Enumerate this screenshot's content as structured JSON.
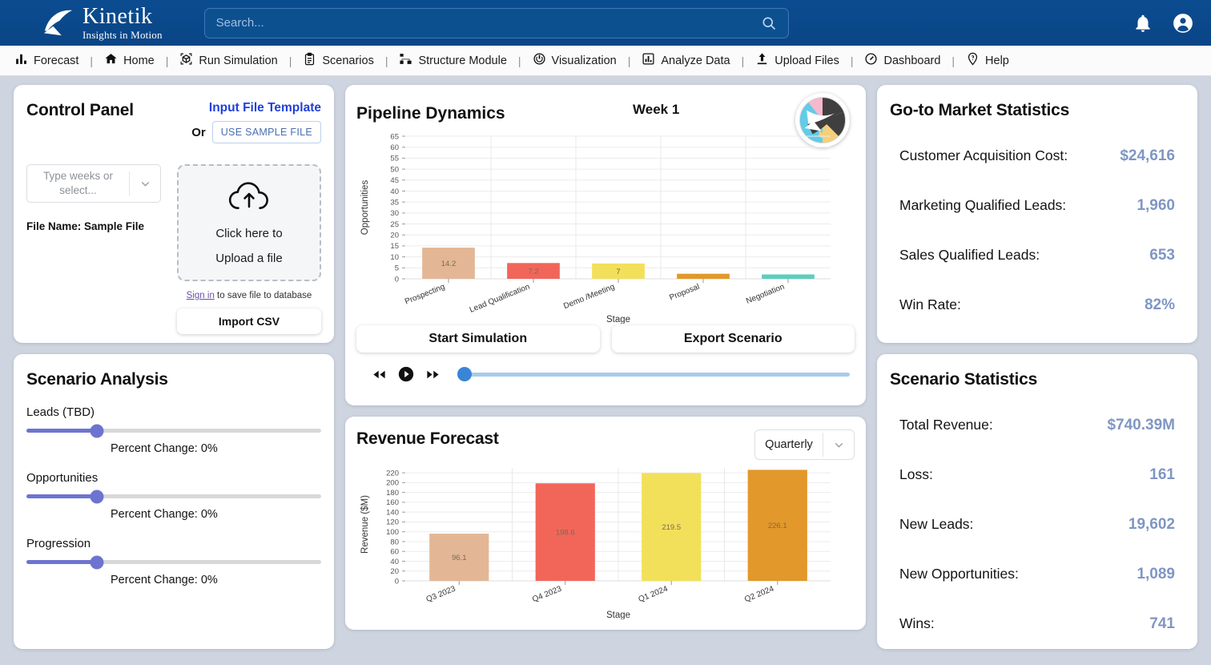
{
  "header": {
    "logo_title": "Kinetik",
    "logo_subtitle": "Insights in Motion",
    "search_placeholder": "Search...",
    "search_value": "",
    "notifications_icon": "bell-icon",
    "account_icon": "account-circle-icon"
  },
  "nav": {
    "items": [
      {
        "label": "Forecast",
        "icon": "bar-chart-icon"
      },
      {
        "label": "Home",
        "icon": "home-icon"
      },
      {
        "label": "Run Simulation",
        "icon": "cube-scan-icon"
      },
      {
        "label": "Scenarios",
        "icon": "clipboard-icon"
      },
      {
        "label": "Structure Module",
        "icon": "sitemap-icon"
      },
      {
        "label": "Visualization",
        "icon": "power-icon"
      },
      {
        "label": "Analyze Data",
        "icon": "bar-chart-box-icon"
      },
      {
        "label": "Upload Files",
        "icon": "upload-icon"
      },
      {
        "label": "Dashboard",
        "icon": "speedometer-icon"
      },
      {
        "label": "Help",
        "icon": "help-pin-icon"
      }
    ],
    "separator": "|"
  },
  "control_panel": {
    "title": "Control Panel",
    "template_link": "Input File Template",
    "or_label": "Or",
    "sample_button": "USE SAMPLE FILE",
    "weeks_placeholder": "Type weeks or select...",
    "file_name": "File Name: Sample File",
    "dropzone_line1": "Click here to",
    "dropzone_line2": "Upload a file",
    "signin_link": "Sign in",
    "signin_rest": " to save file to database",
    "import_button": "Import CSV"
  },
  "scenario_analysis": {
    "title": "Scenario Analysis",
    "sliders": [
      {
        "label": "Leads (TBD)",
        "percent_text": "Percent Change: 0%",
        "value": 24
      },
      {
        "label": "Opportunities",
        "percent_text": "Percent Change: 0%",
        "value": 24
      },
      {
        "label": "Progression",
        "percent_text": "Percent Change: 0%",
        "value": 24
      }
    ]
  },
  "pipeline": {
    "title": "Pipeline Dynamics",
    "week_label": "Week 1",
    "badge_icon": "kinetik-circle-logo",
    "start_button": "Start Simulation",
    "export_button": "Export Scenario",
    "rewind_icon": "rewind-icon",
    "play_icon": "play-icon",
    "forward_icon": "fast-forward-icon",
    "timeline_value": 1
  },
  "revenue": {
    "title": "Revenue Forecast",
    "period_selected": "Quarterly",
    "period_caret_icon": "chevron-down-icon"
  },
  "gtm_stats": {
    "title": "Go-to Market Statistics",
    "rows": [
      {
        "label": "Customer Acquisition Cost:",
        "value": "$24,616"
      },
      {
        "label": "Marketing Qualified Leads:",
        "value": "1,960"
      },
      {
        "label": "Sales Qualified Leads:",
        "value": "653"
      },
      {
        "label": "Win Rate:",
        "value": "82%"
      }
    ]
  },
  "scenario_stats": {
    "title": "Scenario Statistics",
    "rows": [
      {
        "label": "Total Revenue:",
        "value": "$740.39M"
      },
      {
        "label": "Loss:",
        "value": "161"
      },
      {
        "label": "New Leads:",
        "value": "19,602"
      },
      {
        "label": "New Opportunities:",
        "value": "1,089"
      },
      {
        "label": "Wins:",
        "value": "741"
      }
    ]
  },
  "colors": {
    "header_blue": "#0a4a8c",
    "accent_link": "#2040d8",
    "stat_value": "#7f96c4",
    "slider_purple": "#6d74cf",
    "timeline_blue": "#3a85d6"
  },
  "chart_data": [
    {
      "type": "bar",
      "title": "Pipeline Dynamics",
      "subtitle": "Week 1",
      "categories": [
        "Prospecting",
        "Lead Qualification",
        "Demo /Meeting",
        "Proposal",
        "Negotiation"
      ],
      "values": [
        14.2,
        7.2,
        7,
        2.3,
        2
      ],
      "data_labels": [
        "14.2",
        "7.2",
        "7",
        "",
        ""
      ],
      "colors": [
        "#e3b796",
        "#f2665a",
        "#f2e05a",
        "#e2982a",
        "#5ecdbd"
      ],
      "xlabel": "Stage",
      "ylabel": "Opportunities",
      "ylim": [
        0,
        65
      ],
      "yticks": [
        0,
        5,
        10,
        15,
        20,
        25,
        30,
        35,
        40,
        45,
        50,
        55,
        60,
        65
      ],
      "grid": true,
      "legend": "none"
    },
    {
      "type": "bar",
      "title": "Revenue Forecast",
      "categories": [
        "Q3 2023",
        "Q4 2023",
        "Q1 2024",
        "Q2 2024"
      ],
      "values": [
        96.1,
        198.6,
        219.5,
        226.1
      ],
      "data_labels": [
        "96.1",
        "198.6",
        "219.5",
        "226.1"
      ],
      "colors": [
        "#e3b796",
        "#f2665a",
        "#f2e05a",
        "#e2982a"
      ],
      "xlabel": "Stage",
      "ylabel": "Revenue ($M)",
      "ylim": [
        0,
        230
      ],
      "yticks": [
        0,
        20,
        40,
        60,
        80,
        100,
        120,
        140,
        160,
        180,
        200,
        220
      ],
      "grid": true,
      "legend": "none"
    }
  ]
}
